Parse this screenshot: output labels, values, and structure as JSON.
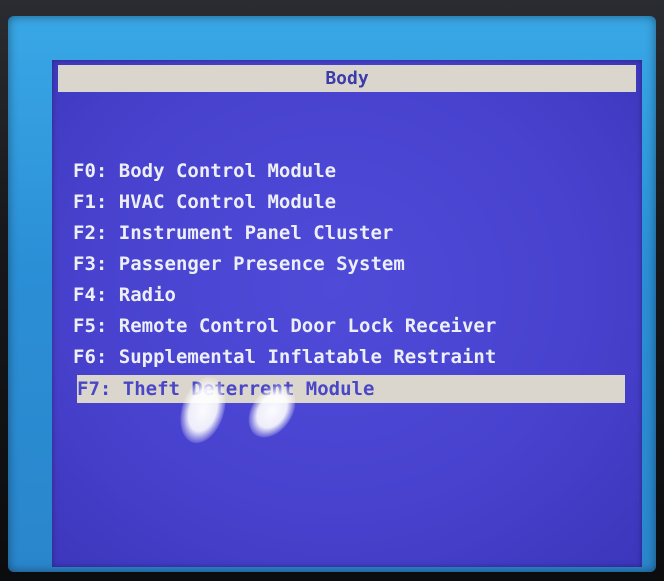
{
  "header": {
    "title": "Body"
  },
  "menu": {
    "items": [
      {
        "key": "F0:",
        "label": "Body Control Module",
        "selected": false
      },
      {
        "key": "F1:",
        "label": "HVAC Control Module",
        "selected": false
      },
      {
        "key": "F2:",
        "label": "Instrument Panel Cluster",
        "selected": false
      },
      {
        "key": "F3:",
        "label": "Passenger Presence System",
        "selected": false
      },
      {
        "key": "F4:",
        "label": "Radio",
        "selected": false
      },
      {
        "key": "F5:",
        "label": "Remote Control Door Lock Receiver",
        "selected": false
      },
      {
        "key": "F6:",
        "label": "Supplemental Inflatable Restraint",
        "selected": false
      },
      {
        "key": "F7:",
        "label": "Theft Deterrent Module",
        "selected": true
      }
    ]
  },
  "colors": {
    "screen_background": "#4842cf",
    "highlight_bar": "#dbd6cd",
    "menu_text": "#eceff8",
    "title_text": "#3b3caa"
  }
}
